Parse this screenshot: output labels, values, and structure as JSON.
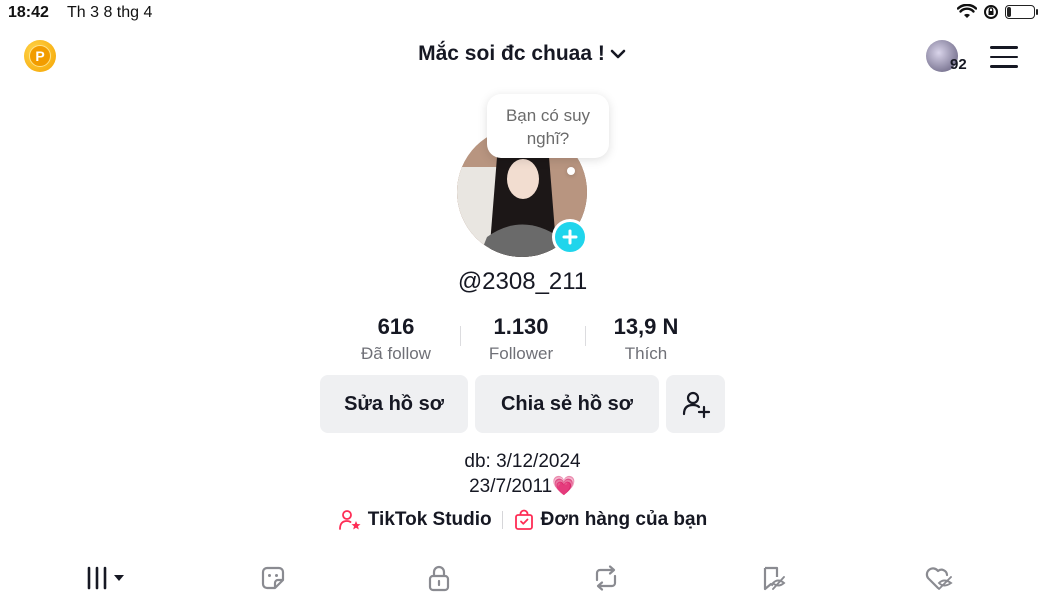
{
  "status_bar": {
    "time": "18:42",
    "date": "Th 3 8 thg 4"
  },
  "header": {
    "title": "Mắc soi đc chuaa !",
    "friends_count": "92",
    "coin_letter": "P"
  },
  "profile": {
    "bubble_text": "Bạn có suy nghĩ?",
    "username": "@2308_211"
  },
  "stats": [
    {
      "value": "616",
      "label": "Đã follow"
    },
    {
      "value": "1.130",
      "label": "Follower"
    },
    {
      "value": "13,9 N",
      "label": "Thích"
    }
  ],
  "buttons": {
    "edit_profile": "Sửa hồ sơ",
    "share_profile": "Chia sẻ hồ sơ"
  },
  "bio": {
    "line1": "db: 3/12/2024",
    "line2": "23/7/2011💗"
  },
  "links": {
    "studio": "TikTok Studio",
    "orders": "Đơn hàng của bạn"
  },
  "tabs": [
    "videos-grid",
    "stickers",
    "private",
    "reposts",
    "favorites",
    "liked"
  ],
  "colors": {
    "accent": "#20d5ec",
    "link_pink": "#fe2c55",
    "button_bg": "#eff0f2"
  }
}
